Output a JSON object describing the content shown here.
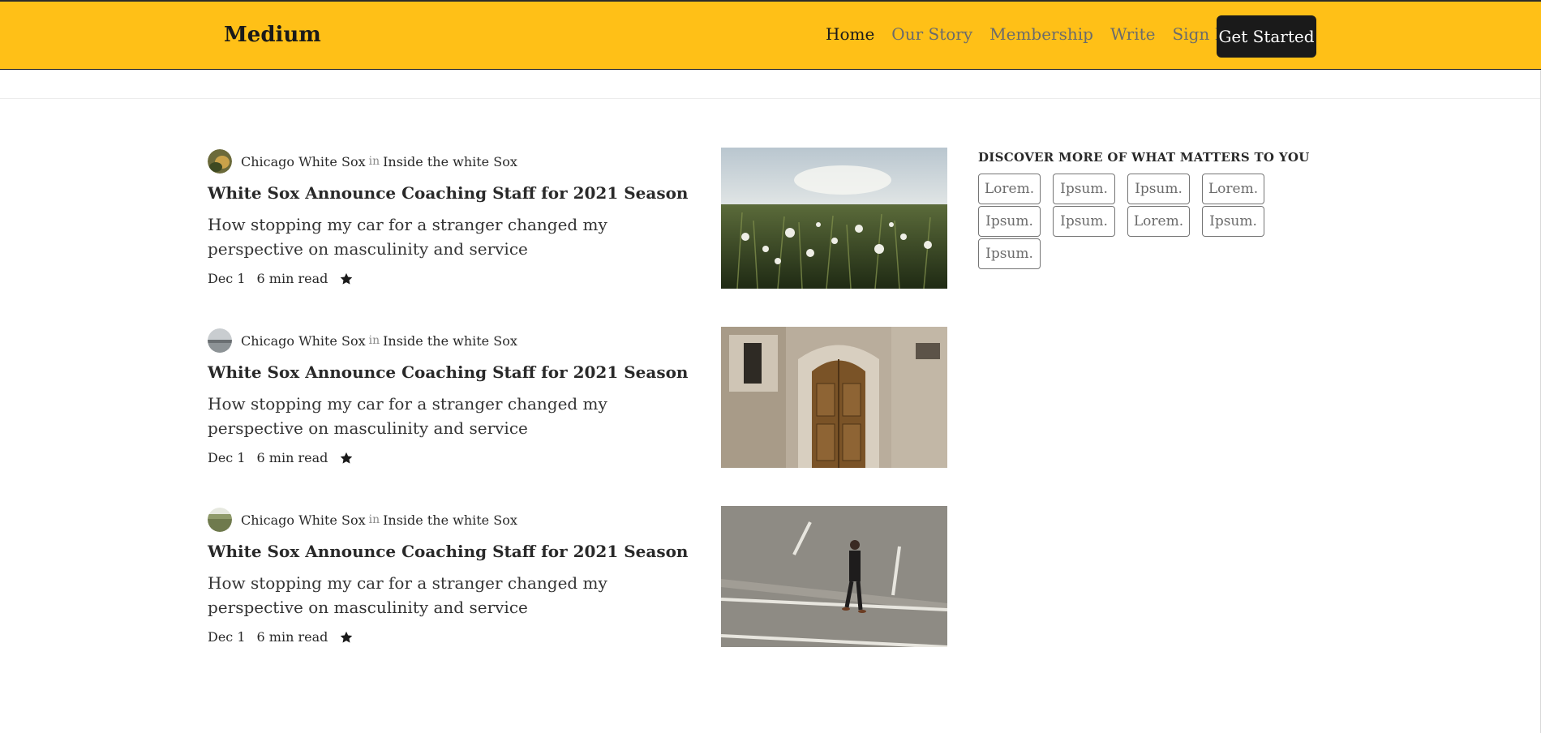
{
  "navbar": {
    "brand": "Medium",
    "links": [
      "Home",
      "Our Story",
      "Membership",
      "Write",
      "Sign In"
    ],
    "cta": "Get Started",
    "bg_color": "#ffc017"
  },
  "articles": [
    {
      "author": "Chicago White Sox",
      "in_label": "in",
      "publication": "Inside the white Sox",
      "title": "White Sox Announce Coaching Staff for 2021 Season",
      "subtitle": "How stopping my car for a stranger changed my perspective on masculinity and service",
      "date": "Dec 1",
      "read_time": "6 min read",
      "thumbnail": "dandelion-field-image"
    },
    {
      "author": "Chicago White Sox",
      "in_label": "in",
      "publication": "Inside the white Sox",
      "title": "White Sox Announce Coaching Staff for 2021 Season",
      "subtitle": "How stopping my car for a stranger changed my perspective on masculinity and service",
      "date": "Dec 1",
      "read_time": "6 min read",
      "thumbnail": "wooden-door-image"
    },
    {
      "author": "Chicago White Sox",
      "in_label": "in",
      "publication": "Inside the white Sox",
      "title": "White Sox Announce Coaching Staff for 2021 Season",
      "subtitle": "How stopping my car for a stranger changed my perspective on masculinity and service",
      "date": "Dec 1",
      "read_time": "6 min read",
      "thumbnail": "man-walking-street-image"
    }
  ],
  "discover": {
    "title": "DISCOVER MORE OF WHAT MATTERS TO YOU",
    "tags": [
      "Lorem.",
      "Ipsum.",
      "Ipsum.",
      "Lorem.",
      "Ipsum.",
      "Ipsum.",
      "Lorem.",
      "Ipsum.",
      "Ipsum."
    ]
  }
}
